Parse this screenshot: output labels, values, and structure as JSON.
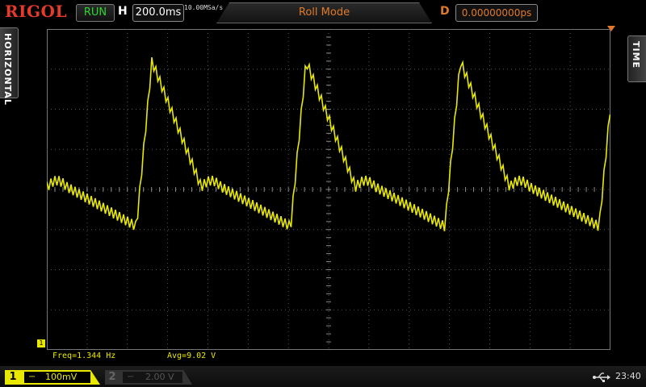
{
  "header": {
    "logo": "RIGOL",
    "run_state": "RUN",
    "h_label": "H",
    "timebase": "200.0ms",
    "sample_rate": "10.00MSa/s",
    "mode": "Roll Mode",
    "d_label": "D",
    "delay": "0.00000000ps"
  },
  "side": {
    "left_tab": "HORIZONTAL",
    "right_tab": "TIME"
  },
  "channel_marker": "1",
  "measurements": {
    "freq": "Freq=1.344 Hz",
    "avg": "Avg=9.02 V"
  },
  "footer": {
    "ch1_num": "1",
    "ch1_coupling_icon": "dc-coupling-icon",
    "ch1_scale": "100mV",
    "ch2_num": "2",
    "ch2_coupling_icon": "dc-coupling-icon",
    "ch2_scale": "2.00 V",
    "usb_icon": "usb-icon",
    "time": "23:40"
  },
  "colors": {
    "trace": "#e8e800",
    "grid": "#555555",
    "accent": "#e07a2a",
    "logo": "#e63a2b"
  }
}
